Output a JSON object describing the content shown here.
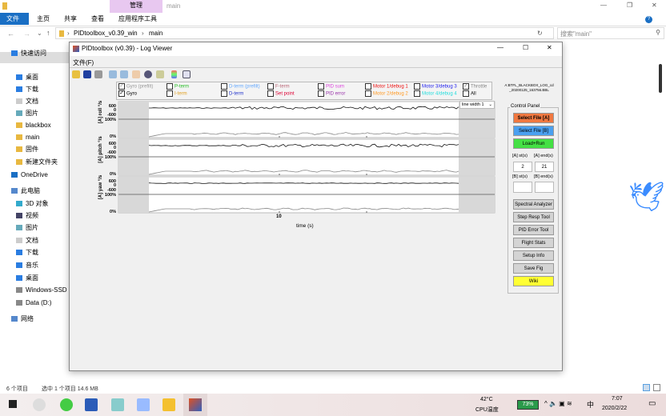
{
  "explorer": {
    "title_tab": "管理",
    "title_text": "main",
    "ribbon_tabs": [
      "文件",
      "主页",
      "共享",
      "查看",
      "应用程序工具"
    ],
    "breadcrumb": [
      "PIDtoolbox_v0.39_win",
      "main"
    ],
    "search_placeholder": "搜索\"main\"",
    "sidebar": [
      {
        "label": "快速访问",
        "icon": "star-icon"
      },
      {
        "label": "桌面",
        "icon": "desktop-icon"
      },
      {
        "label": "下载",
        "icon": "download-icon"
      },
      {
        "label": "文档",
        "icon": "document-icon"
      },
      {
        "label": "图片",
        "icon": "pictures-icon"
      },
      {
        "label": "blackbox",
        "icon": "folder-icon"
      },
      {
        "label": "main",
        "icon": "folder-icon"
      },
      {
        "label": "固件",
        "icon": "folder-icon"
      },
      {
        "label": "新建文件夹",
        "icon": "folder-icon"
      },
      {
        "label": "OneDrive",
        "icon": "cloud-icon"
      },
      {
        "label": "此电脑",
        "icon": "computer-icon"
      },
      {
        "label": "3D 对象",
        "icon": "cube-icon"
      },
      {
        "label": "视频",
        "icon": "video-icon"
      },
      {
        "label": "图片",
        "icon": "pictures-icon"
      },
      {
        "label": "文档",
        "icon": "document-icon"
      },
      {
        "label": "下载",
        "icon": "download-icon"
      },
      {
        "label": "音乐",
        "icon": "music-icon"
      },
      {
        "label": "桌面",
        "icon": "desktop-icon"
      },
      {
        "label": "Windows-SSD",
        "icon": "drive-icon"
      },
      {
        "label": "Data (D:)",
        "icon": "drive-icon"
      },
      {
        "label": "网络",
        "icon": "network-icon"
      }
    ],
    "status_count": "6 个项目",
    "status_selected": "选中 1 个项目  14.6 MB"
  },
  "app": {
    "title": "PIDtoolbox (v0.39) - Log Viewer",
    "menu": "文件(F)",
    "filename": "A:BTFL_BLACKBOX_LOG_cd\n_20200125_163756.BBL",
    "checkboxes": [
      {
        "label": "Gyro (prefilt)",
        "checked": true,
        "color": "#999999"
      },
      {
        "label": "Gyro",
        "checked": true,
        "color": "#000000"
      },
      {
        "label": "P-term",
        "checked": false,
        "color": "#22bb22"
      },
      {
        "label": "I-term",
        "checked": false,
        "color": "#e0a020"
      },
      {
        "label": "D-term (prefilt)",
        "checked": false,
        "color": "#66aaff"
      },
      {
        "label": "D-term",
        "checked": false,
        "color": "#2233cc"
      },
      {
        "label": "F-term",
        "checked": false,
        "color": "#bb6677"
      },
      {
        "label": "Set point",
        "checked": false,
        "color": "#dd0033"
      },
      {
        "label": "PID sum",
        "checked": false,
        "color": "#dd44dd"
      },
      {
        "label": "PID error",
        "checked": false,
        "color": "#9933aa"
      },
      {
        "label": "Motor 1/debug 1",
        "checked": false,
        "color": "#ee1111"
      },
      {
        "label": "Motor 2/debug 2",
        "checked": false,
        "color": "#ff9922"
      },
      {
        "label": "Motor 3/debug 3",
        "checked": false,
        "color": "#2222ee"
      },
      {
        "label": "Motor 4/debug 4",
        "checked": false,
        "color": "#22dddd"
      },
      {
        "label": "Throttle",
        "checked": true,
        "color": "#888888"
      },
      {
        "label": "All",
        "checked": false,
        "color": "#000000"
      }
    ],
    "line_width": "line width 1",
    "plots": [
      {
        "ylabel": "[A] roll °/s",
        "ticks": [
          "600",
          "0",
          "-600"
        ]
      },
      {
        "ylabel": "[A] pitch °/s",
        "ticks": [
          "600",
          "0",
          "-600"
        ]
      },
      {
        "ylabel": "[A] yaw °/s",
        "ticks": [
          "600",
          "0",
          "-600"
        ]
      }
    ],
    "throttle_ticks": [
      "100%",
      "0%"
    ],
    "xtick": "10",
    "xlabel": "time (s)",
    "control_panel": {
      "title": "Control Panel",
      "select_a": "Select File [A]",
      "select_b": "Select File [B]",
      "load_run": "Load+Run",
      "a_start_label": "[A] st(s)",
      "a_end_label": "[A] end(s)",
      "a_start": "2",
      "a_end": "21",
      "b_start_label": "[B] st(s)",
      "b_end_label": "[B] end(s)",
      "b_start": "",
      "b_end": "",
      "tools": [
        "Spectral Analyzer",
        "Step Resp Tool",
        "PID Error Tool",
        "Flight Stats",
        "Setup Info",
        "Save Fig"
      ],
      "wiki": "Wiki",
      "colors": {
        "select_a": "#f07840",
        "select_b": "#4aa0f0",
        "load_run": "#44e044",
        "wiki": "#ffff33"
      }
    }
  },
  "taskbar": {
    "temp": "42°C",
    "temp_label": "CPU温度",
    "battery": "73%",
    "ime": "中",
    "time": "7:07",
    "date": "2020/2/22"
  }
}
